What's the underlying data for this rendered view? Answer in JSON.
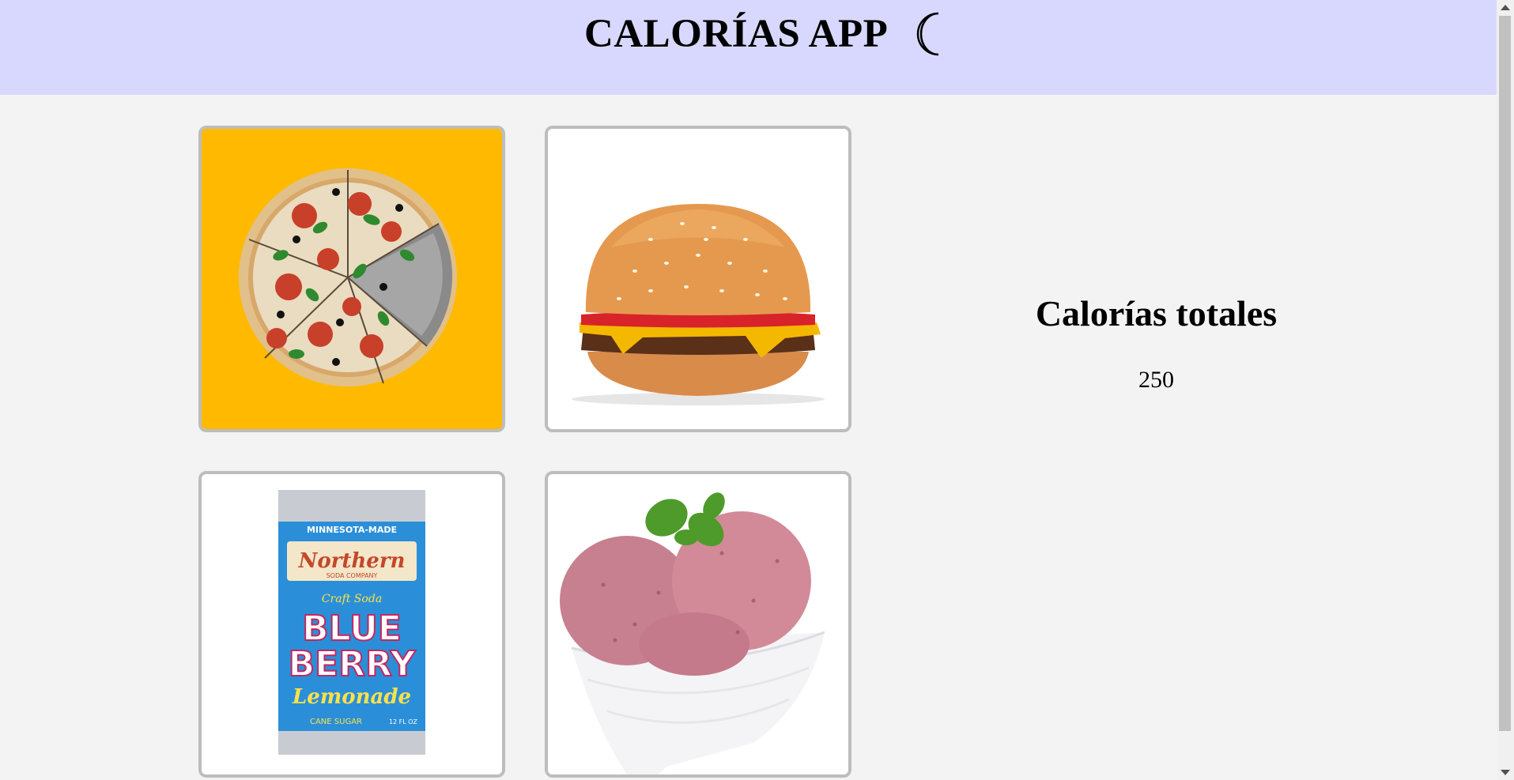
{
  "header": {
    "title": "CALORÍAS APP",
    "theme_toggle_icon": "moon-icon",
    "background": "#d8d8ff"
  },
  "foods": [
    {
      "name": "pizza",
      "icon": "pizza-image",
      "selected": true,
      "accent": "#ffba00"
    },
    {
      "name": "burger",
      "icon": "burger-image",
      "selected": false
    },
    {
      "name": "soda",
      "icon": "soda-can-image",
      "selected": false
    },
    {
      "name": "ice-cream",
      "icon": "ice-cream-image",
      "selected": false
    }
  ],
  "soda_can": {
    "top_text": "MINNESOTA-MADE",
    "brand": "Northern",
    "brand_sub": "SODA COMPANY",
    "craft": "Craft Soda",
    "line1": "BLUE",
    "line2": "BERRY",
    "flavor": "Lemonade",
    "cane": "CANE SUGAR",
    "volume": "12 FL OZ"
  },
  "totals": {
    "title": "Calorías totales",
    "value": "250"
  }
}
